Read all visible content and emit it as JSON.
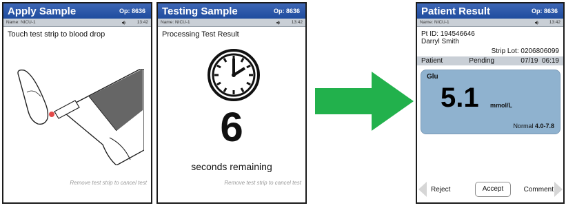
{
  "screens": [
    {
      "title": "Apply Sample",
      "op": "Op: 8636",
      "name": "Name: NICU-1",
      "time": "13:42",
      "message": "Touch test strip to blood drop",
      "hint": "Remove test strip to cancel test"
    },
    {
      "title": "Testing Sample",
      "op": "Op: 8636",
      "name": "Name: NICU-1",
      "time": "13:42",
      "message": "Processing Test Result",
      "count": "6",
      "seconds_label": "seconds remaining",
      "hint": "Remove test strip to cancel test"
    },
    {
      "title": "Patient Result",
      "op": "Op: 8636",
      "name": "Name: NICU-1",
      "time": "13:42",
      "pt_id": "Pt ID: 194546646",
      "patient_name": "Darryl Smith",
      "strip_lot": "Strip Lot: 0206806099",
      "bar_patient": "Patient",
      "bar_pending": "Pending",
      "bar_date": "07/19",
      "bar_time": "06:19",
      "analyte": "Glu",
      "value": "5.1",
      "unit": "mmol/L",
      "normal_label": "Normal",
      "normal_range": "4.0-7.8",
      "reject_label": "Reject",
      "accept_label": "Accept",
      "comment_label": "Comment"
    }
  ],
  "colors": {
    "titlebar": "#2a56a8",
    "arrow": "#22b14c",
    "result_box": "#8fb2cf"
  },
  "icons": {
    "speaker": "speaker-icon",
    "clock": "clock-icon",
    "arrow": "arrow-right-icon",
    "strip": "test-strip-illustration"
  }
}
